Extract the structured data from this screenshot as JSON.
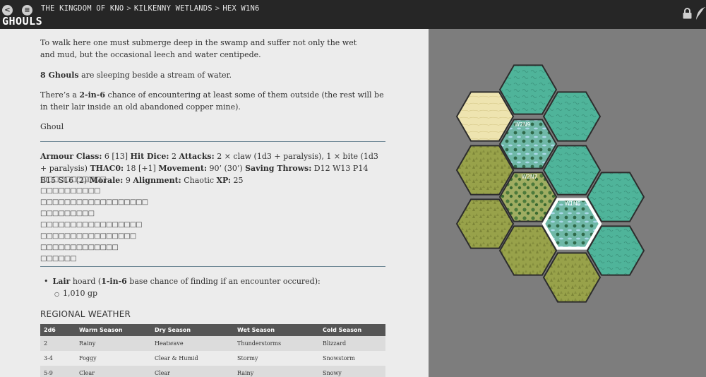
{
  "header": {
    "share_icon": "share-icon",
    "menu_icon": "menu-icon",
    "breadcrumbs": [
      "THE KINGDOM OF KNO",
      "KILKENNY WETLANDS",
      "HEX W1N6"
    ],
    "separator": ">",
    "page_title": "GHOULS",
    "lock_icon": "lock-icon",
    "edit_icon": "feather-icon"
  },
  "main": {
    "intro": "To walk here one must submerge deep in the swamp and suffer not only the wet and mud, but the occasional leech and water centipede.",
    "count_bold": "8 Ghouls",
    "count_rest": " are sleeping beside a stream of water.",
    "chance_pre": "There’s a ",
    "chance_bold": "2-in-6",
    "chance_post": " chance of encountering at least some of them outside (the rest will be in their lair inside an old abandoned copper mine).",
    "monster_name": "Ghoul",
    "stats": {
      "ac_label": "Armour Class:",
      "ac": " 6 [13] ",
      "hd_label": "Hit Dice:",
      "hd": " 2 ",
      "atk_label": "Attacks:",
      "atk": " 2 × claw (1d3 + paralysis), 1 × bite (1d3 + paralysis) ",
      "thac0_label": "THAC0:",
      "thac0": " 18 [+1] ",
      "mv_label": "Movement:",
      "mv": " 90’ (30’) ",
      "st_label": "Saving Throws:",
      "st": " D12 W13 P14 B15 S16 (2) ",
      "ml_label": "Morale:",
      "ml": " 9 ",
      "al_label": "Alignment:",
      "al": " Chaotic ",
      "xp_label": "XP:",
      "xp": " 25"
    },
    "hp_boxes": [
      "□□□□□□□□□□□",
      "□□□□□□□□□□",
      "□□□□□□□□□□□□□□□□□□",
      "□□□□□□□□□",
      "□□□□□□□□□□□□□□□□□",
      "□□□□□□□□□□□□□□□□",
      "□□□□□□□□□□□□□",
      "□□□□□□"
    ],
    "lair_bold": "Lair",
    "lair_text": " hoard (",
    "lair_chance_bold": "1-in-6",
    "lair_tail": " base chance of finding if an encounter occured):",
    "lair_item": "1,010 gp",
    "weather_heading": "REGIONAL WEATHER",
    "weather_columns": [
      "2d6",
      "Warm Season",
      "Dry Season",
      "Wet Season",
      "Cold Season"
    ],
    "weather_rows": [
      [
        "2",
        "Rainy",
        "Heatwave",
        "Thunderstorms",
        "Blizzard"
      ],
      [
        "3-4",
        "Foggy",
        "Clear & Humid",
        "Stormy",
        "Snowstorm"
      ],
      [
        "5-9",
        "Clear",
        "Clear",
        "Rainy",
        "Snowy"
      ]
    ]
  },
  "map": {
    "hex_labels": [
      "W2N9",
      "W2N7",
      "W1N6"
    ],
    "colors": {
      "swamp_teal": "#4fb49a",
      "forest_olive": "#98a24a",
      "desert_sand": "#eee4b0",
      "marsh_tree": "#7ba35a",
      "background": "#7d7d7d",
      "selected_outline": "#ffffff"
    }
  }
}
